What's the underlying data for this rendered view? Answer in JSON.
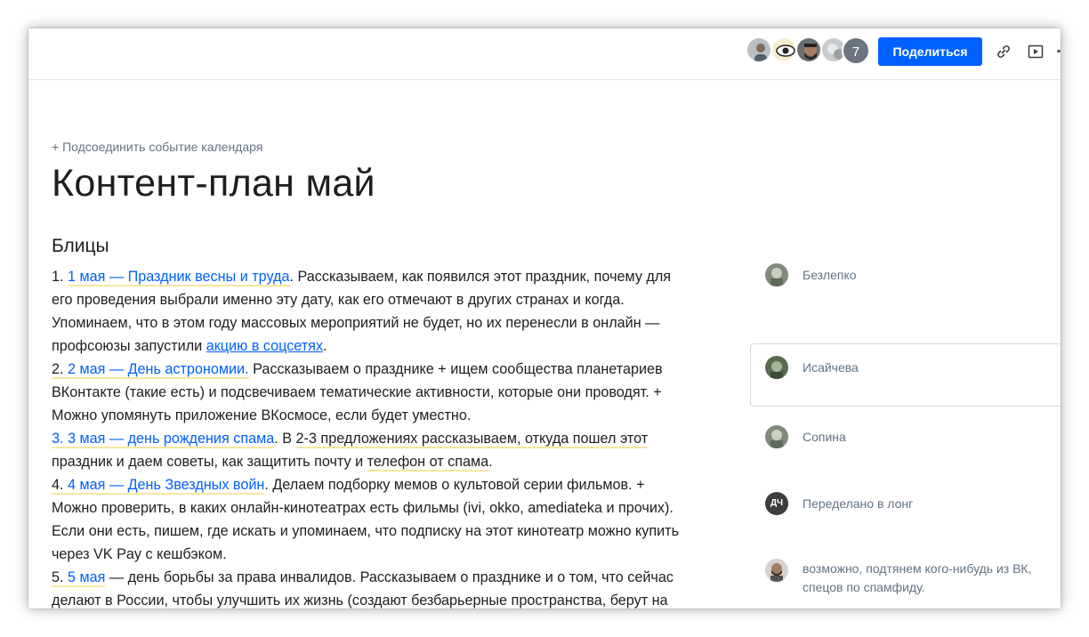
{
  "header": {
    "collaborator_count": "7",
    "share_label": "Поделиться",
    "avatars": [
      "avatar-1",
      "avatar-2",
      "avatar-3",
      "avatar-4"
    ]
  },
  "document": {
    "connect_calendar": "+ Подсоединить событие календаря",
    "title": "Контент-план май",
    "section": "Блицы",
    "lines": {
      "l1_pre": "1.",
      "l1_date": "1 мая — Праздник весны и труда",
      "l1_post": ". Рассказываем, как появился этот праздник, почему для",
      "l2": "его проведения выбрали именно эту дату, как его отмечают в других странах и когда.",
      "l3": "Упоминаем, что в этом году массовых мероприятий не будет, но их перенесли в онлайн —",
      "l4_pre": "профсоюзы запустили ",
      "l4_link": "акцию в соцсетях",
      "l4_post": ".",
      "l5_pre": "2. ",
      "l5_date": "2 мая — День астрономии.",
      "l5_post": " Рассказываем о празднике + ищем сообщества планетариев",
      "l6": "ВКонтакте (такие есть) и подсвечиваем тематические активности, которые они проводят. +",
      "l7": "Можно упомянуть приложение ВКосмосе, если будет уместно.",
      "l8_date": "3. 3 мая — день рождения спама",
      "l8_mid": ". В ",
      "l8_hl": "2-3 предложениях рассказываем, откуда пошел этот",
      "l9_pre": "праздник и даем советы, как защитить почту и ",
      "l9_hl": "телефон от спама",
      "l9_post": ".",
      "l10_pre": "4. ",
      "l10_date": "4 мая — День Звездных войн",
      "l10_post": ". Делаем подборку мемов о культовой серии фильмов. +",
      "l11": "Можно проверить, в каких онлайн-кинотеатрах есть фильмы (ivi, okko, amediateka и прочих).",
      "l12": "Если они есть, пишем, где искать и упоминаем, что подписку на этот кинотеатр можно купить",
      "l13": "через VK Pay с кешбэком.",
      "l14_pre": "5. ",
      "l14_date": "5 мая",
      "l14_post": " — день борьбы за права инвалидов. Рассказываем о празднике и о том, что сейчас",
      "l15": "делают в России, чтобы улучшить их жизнь (создают безбарьерные пространства, берут на"
    }
  },
  "comments": [
    {
      "author": "Безлепко"
    },
    {
      "author": "Исайчева"
    },
    {
      "author": "Сопина"
    },
    {
      "initials": "ДЧ",
      "text": "Переделано в лонг"
    },
    {
      "text_line1": "возможно, подтянем кого-нибудь из ВК,",
      "text_line2": "спецов по спамфиду."
    }
  ],
  "colors": {
    "accent": "#0061fe",
    "muted_text": "#637282",
    "highlight_underline": "#f5e6a3"
  }
}
